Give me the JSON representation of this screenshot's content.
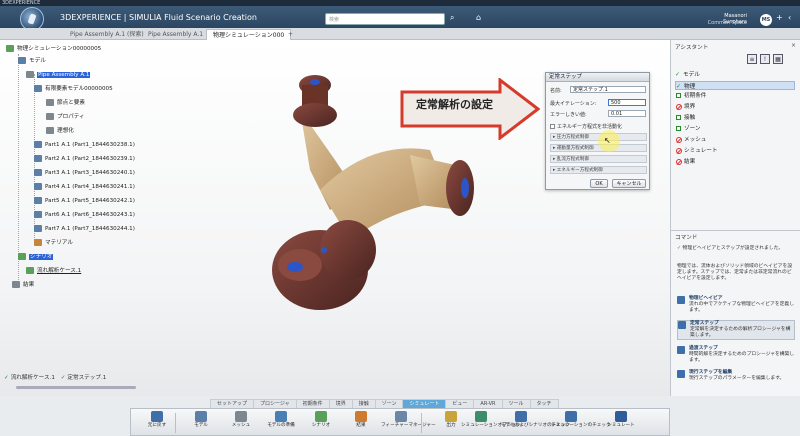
{
  "os": {
    "title": "3DEXPERIENCE"
  },
  "header": {
    "brand": "3DEXPERIENCE | SIMULIA Fluid Scenario Creation",
    "search_placeholder": "検索",
    "user_name": "Masanori Sunohara",
    "user_collab": "Common Space",
    "avatar": "MS"
  },
  "tabs": [
    {
      "label": "Pipe Assembly A.1 (探索)"
    },
    {
      "label": "Pipe Assembly A.1"
    },
    {
      "label": "物理シミュレーション000"
    },
    {
      "label": "+"
    }
  ],
  "tree": {
    "root": "物理シミュレーション00000005",
    "model": "モデル",
    "assembly": "Pipe Assembly A.1",
    "finite_model": "有限要素モデル00000005",
    "nodes_elements": "節点と要素",
    "properties": "プロパティ",
    "idealization": "理想化",
    "parts": [
      "Part1 A.1 (Part1_1844630238.1)",
      "Part2 A.1 (Part2_1844630239.1)",
      "Part3 A.1 (Part3_1844630240.1)",
      "Part4 A.1 (Part4_1844630241.1)",
      "Part5 A.1 (Part5_1844630242.1)",
      "Part6 A.1 (Part6_1844630243.1)",
      "Part7 A.1 (Part7_1844630244.1)"
    ],
    "material": "マテリアル",
    "scenario": "シナリオ",
    "flow_case": "流れ解析ケース.1",
    "results": "結果"
  },
  "annotation": {
    "text": "定常解析の設定"
  },
  "dialog": {
    "title": "定常ステップ",
    "name_label": "名前:",
    "name_value": "定常ステップ.1",
    "max_iter_label": "最大イテレーション:",
    "max_iter_value": "500",
    "error_label": "エラーしきい値:",
    "error_value": "0.01",
    "energy_check": "エネルギー方程式を非活動化",
    "sections": [
      "圧力方程式制御",
      "運動量方程式制御",
      "乱流方程式制御",
      "エネルギー方程式制御"
    ],
    "ok": "OK",
    "cancel": "キャンセル"
  },
  "assistant": {
    "title": "アシスタント",
    "close": "×",
    "icons": [
      "≡",
      "!",
      "▦"
    ],
    "items": [
      {
        "label": "モデル",
        "state": "done"
      },
      {
        "label": "物理",
        "state": "done"
      },
      {
        "label": "初期条件",
        "state": "todo"
      },
      {
        "label": "境界",
        "state": "missing"
      },
      {
        "label": "接触",
        "state": "todo"
      },
      {
        "label": "ゾーン",
        "state": "todo"
      },
      {
        "label": "メッシュ",
        "state": "missing"
      },
      {
        "label": "シミュレート",
        "state": "missing"
      },
      {
        "label": "結果",
        "state": "missing"
      }
    ],
    "commands_title": "コマンド",
    "commands_note": "物理ビヘイビアとステップが設定されました。",
    "commands_desc": "物理では、流体およびソリッド領域のビヘイビアを設定します。ステップでは、定常または非定常流れのビヘイビアを設定します。",
    "commands": [
      {
        "title": "物理ビヘイビア",
        "desc": "流れの中でアクティブな物理ビヘイビアを定義します。"
      },
      {
        "title": "定常ステップ",
        "desc": "定常解を決定するための解析プロシージャを構築します。"
      },
      {
        "title": "過渡ステップ",
        "desc": "時間的解を決定するためのプロシージャを構築します。"
      },
      {
        "title": "現行ステップを編集",
        "desc": "現行ステップのパラメーターを編集します。"
      }
    ]
  },
  "status": {
    "items": [
      "流れ解析ケース.1",
      "定常ステップ.1"
    ]
  },
  "toolbar": {
    "categories": [
      "セットアップ",
      "プロシージャ",
      "初期条件",
      "境界",
      "接触",
      "ゾーン",
      "シミュレート",
      "ビュー",
      "AR-VR",
      "ツール",
      "タッチ"
    ],
    "active_category": "シミュレート",
    "buttons": [
      {
        "label": "元に戻す",
        "color": "#3e6fa8"
      },
      {
        "label": "モデル",
        "color": "#5b7fa6"
      },
      {
        "label": "メッシュ",
        "color": "#7d8790"
      },
      {
        "label": "モデルの準備",
        "color": "#4a7fb6"
      },
      {
        "label": "シナリオ",
        "color": "#59a05a"
      },
      {
        "label": "結果",
        "color": "#d07a30"
      },
      {
        "label": "フィーチャーマネージャー",
        "color": "#6b87a8"
      },
      {
        "label": "出力",
        "color": "#c8a43a"
      },
      {
        "label": "シミュレーションオプション",
        "color": "#3d8c6a"
      },
      {
        "label": "モデルおよびシナリオのチェック",
        "color": "#3e6fa8"
      },
      {
        "label": "シミュレーションのチェック",
        "color": "#3e6fa8"
      },
      {
        "label": "シミュレート",
        "color": "#2e5d9a"
      }
    ]
  }
}
